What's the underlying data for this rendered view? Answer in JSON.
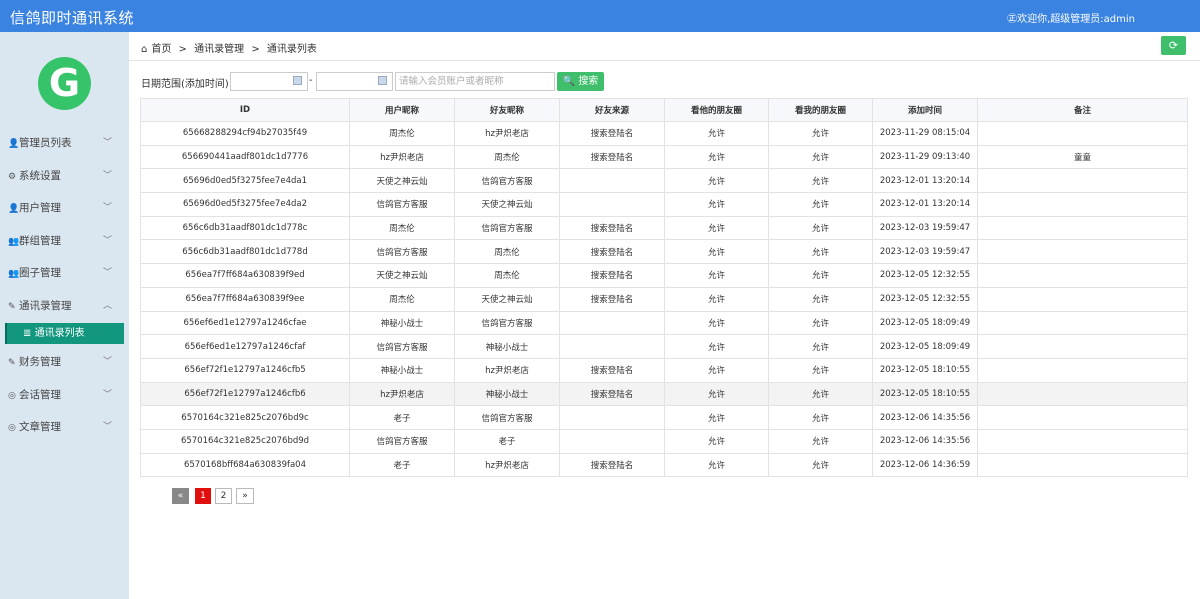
{
  "app": {
    "title": "信鸽即时通讯系统",
    "welcome": "㊣欢迎你,超级管理员:admin"
  },
  "logo": {
    "letter": "G"
  },
  "sidebar": {
    "items": [
      {
        "icon": "user-icon",
        "glyph": "👤",
        "label": "管理员列表",
        "chev": "﹀"
      },
      {
        "icon": "gear-icon",
        "glyph": "⚙",
        "label": "系统设置",
        "chev": "﹀"
      },
      {
        "icon": "user-icon",
        "glyph": "👤",
        "label": "用户管理",
        "chev": "﹀"
      },
      {
        "icon": "group-icon",
        "glyph": "👥",
        "label": "群组管理",
        "chev": "﹀"
      },
      {
        "icon": "group-icon",
        "glyph": "👥",
        "label": "圈子管理",
        "chev": "﹀"
      },
      {
        "icon": "edit-icon",
        "glyph": "✎",
        "label": "通讯录管理",
        "chev": "︿"
      },
      {
        "icon": "edit-icon",
        "glyph": "✎",
        "label": "财务管理",
        "chev": "﹀"
      },
      {
        "icon": "chat-icon",
        "glyph": "◎",
        "label": "会话管理",
        "chev": "﹀"
      },
      {
        "icon": "chat-icon",
        "glyph": "◎",
        "label": "文章管理",
        "chev": "﹀"
      }
    ],
    "active_sub": {
      "glyph": "≣",
      "label": "通讯录列表"
    }
  },
  "breadcrumb": {
    "home_glyph": "⌂",
    "home": "首页",
    "sep": ">",
    "section": "通讯录管理",
    "page": "通讯录列表"
  },
  "refresh_glyph": "⟳",
  "filter": {
    "label": "日期范围(添加时间):",
    "dash": "-",
    "placeholder": "请输入会员账户或者昵称",
    "search_label": "搜索",
    "search_glyph": "🔍"
  },
  "table": {
    "columns": [
      "ID",
      "用户昵称",
      "好友昵称",
      "好友来源",
      "看他的朋友圈",
      "看我的朋友圈",
      "添加时间",
      "备注"
    ],
    "rows": [
      [
        "65668288294cf94b27035f49",
        "周杰伦",
        "hz尹炽老店",
        "搜索登陆名",
        "允许",
        "允许",
        "2023-11-29 08:15:04",
        ""
      ],
      [
        "656690441aadf801dc1d7776",
        "hz尹炽老店",
        "周杰伦",
        "搜索登陆名",
        "允许",
        "允许",
        "2023-11-29 09:13:40",
        "童童"
      ],
      [
        "65696d0ed5f3275fee7e4da1",
        "天使之神云灿",
        "信鸽官方客服",
        "",
        "允许",
        "允许",
        "2023-12-01 13:20:14",
        ""
      ],
      [
        "65696d0ed5f3275fee7e4da2",
        "信鸽官方客服",
        "天使之神云灿",
        "",
        "允许",
        "允许",
        "2023-12-01 13:20:14",
        ""
      ],
      [
        "656c6db31aadf801dc1d778c",
        "周杰伦",
        "信鸽官方客服",
        "搜索登陆名",
        "允许",
        "允许",
        "2023-12-03 19:59:47",
        ""
      ],
      [
        "656c6db31aadf801dc1d778d",
        "信鸽官方客服",
        "周杰伦",
        "搜索登陆名",
        "允许",
        "允许",
        "2023-12-03 19:59:47",
        ""
      ],
      [
        "656ea7f7ff684a630839f9ed",
        "天使之神云灿",
        "周杰伦",
        "搜索登陆名",
        "允许",
        "允许",
        "2023-12-05 12:32:55",
        ""
      ],
      [
        "656ea7f7ff684a630839f9ee",
        "周杰伦",
        "天使之神云灿",
        "搜索登陆名",
        "允许",
        "允许",
        "2023-12-05 12:32:55",
        ""
      ],
      [
        "656ef6ed1e12797a1246cfae",
        "神秘小战士",
        "信鸽官方客服",
        "",
        "允许",
        "允许",
        "2023-12-05 18:09:49",
        ""
      ],
      [
        "656ef6ed1e12797a1246cfaf",
        "信鸽官方客服",
        "神秘小战士",
        "",
        "允许",
        "允许",
        "2023-12-05 18:09:49",
        ""
      ],
      [
        "656ef72f1e12797a1246cfb5",
        "神秘小战士",
        "hz尹炽老店",
        "搜索登陆名",
        "允许",
        "允许",
        "2023-12-05 18:10:55",
        ""
      ],
      [
        "656ef72f1e12797a1246cfb6",
        "hz尹炽老店",
        "神秘小战士",
        "搜索登陆名",
        "允许",
        "允许",
        "2023-12-05 18:10:55",
        ""
      ],
      [
        "6570164c321e825c2076bd9c",
        "老子",
        "信鸽官方客服",
        "",
        "允许",
        "允许",
        "2023-12-06 14:35:56",
        ""
      ],
      [
        "6570164c321e825c2076bd9d",
        "信鸽官方客服",
        "老子",
        "",
        "允许",
        "允许",
        "2023-12-06 14:35:56",
        ""
      ],
      [
        "6570168bff684a630839fa04",
        "老子",
        "hz尹炽老店",
        "搜索登陆名",
        "允许",
        "允许",
        "2023-12-06 14:36:59",
        ""
      ]
    ],
    "highlighted_row": 11
  },
  "pager": {
    "prev": "«",
    "pages": [
      "1",
      "2"
    ],
    "current": "1",
    "next": "»"
  }
}
